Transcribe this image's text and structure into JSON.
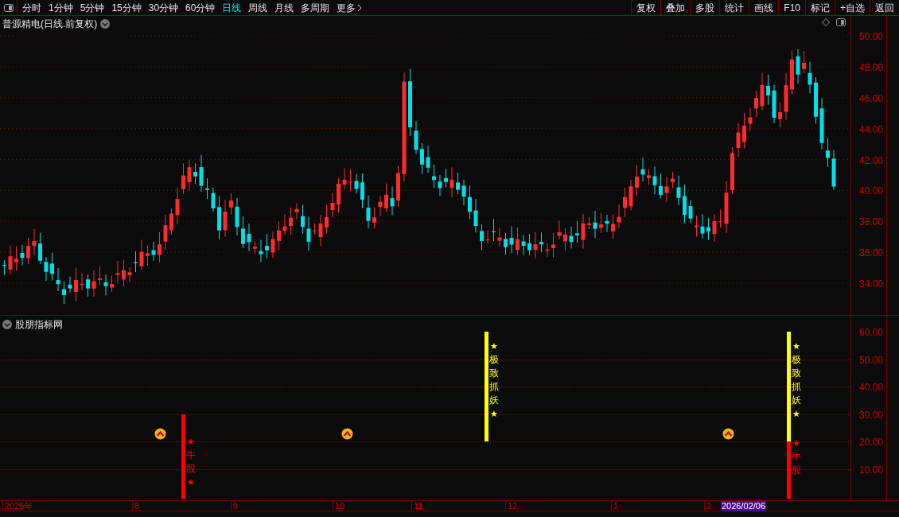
{
  "toolbar": {
    "periods": [
      {
        "label": "分时",
        "selected": false
      },
      {
        "label": "1分钟",
        "selected": false
      },
      {
        "label": "5分钟",
        "selected": false
      },
      {
        "label": "15分钟",
        "selected": false
      },
      {
        "label": "30分钟",
        "selected": false
      },
      {
        "label": "60分钟",
        "selected": false
      },
      {
        "label": "日线",
        "selected": true
      },
      {
        "label": "周线",
        "selected": false
      },
      {
        "label": "月线",
        "selected": false
      },
      {
        "label": "多周期",
        "selected": false
      }
    ],
    "more": "更多",
    "actions": [
      "复权",
      "叠加",
      "多股",
      "统计",
      "画线",
      "F10",
      "标记",
      "+自选",
      "返回"
    ]
  },
  "main_chart": {
    "title": "普源精电(日线.前复权)",
    "price_axis": [
      "50.00",
      "48.00",
      "46.00",
      "44.00",
      "42.00",
      "40.00",
      "38.00",
      "36.00",
      "34.00"
    ]
  },
  "indicator": {
    "title": "股朋指标网",
    "axis": [
      "60.00",
      "50.00",
      "40.00",
      "30.00",
      "20.00",
      "10.00"
    ],
    "signals": [
      {
        "kind": "bull",
        "mark": "★",
        "label": "牛股",
        "mark_end": "★"
      },
      {
        "kind": "demon",
        "mark": "★",
        "label": "极致抓妖",
        "mark_end": "★"
      },
      {
        "kind": "demon",
        "mark": "★",
        "label": "极致抓妖",
        "mark_end": "★"
      },
      {
        "kind": "bull",
        "mark": "★",
        "label": "牛股"
      }
    ]
  },
  "time_axis": [
    {
      "label": "2025年",
      "kind": "tick"
    },
    {
      "label": "8",
      "kind": "tick"
    },
    {
      "label": "9",
      "kind": "tick"
    },
    {
      "label": "10",
      "kind": "tick"
    },
    {
      "label": "11",
      "kind": "tick"
    },
    {
      "label": "12",
      "kind": "tick"
    },
    {
      "label": "1",
      "kind": "tick"
    },
    {
      "label": "2",
      "kind": "tick"
    },
    {
      "label": "2026/02/06",
      "kind": "cursor"
    }
  ]
}
